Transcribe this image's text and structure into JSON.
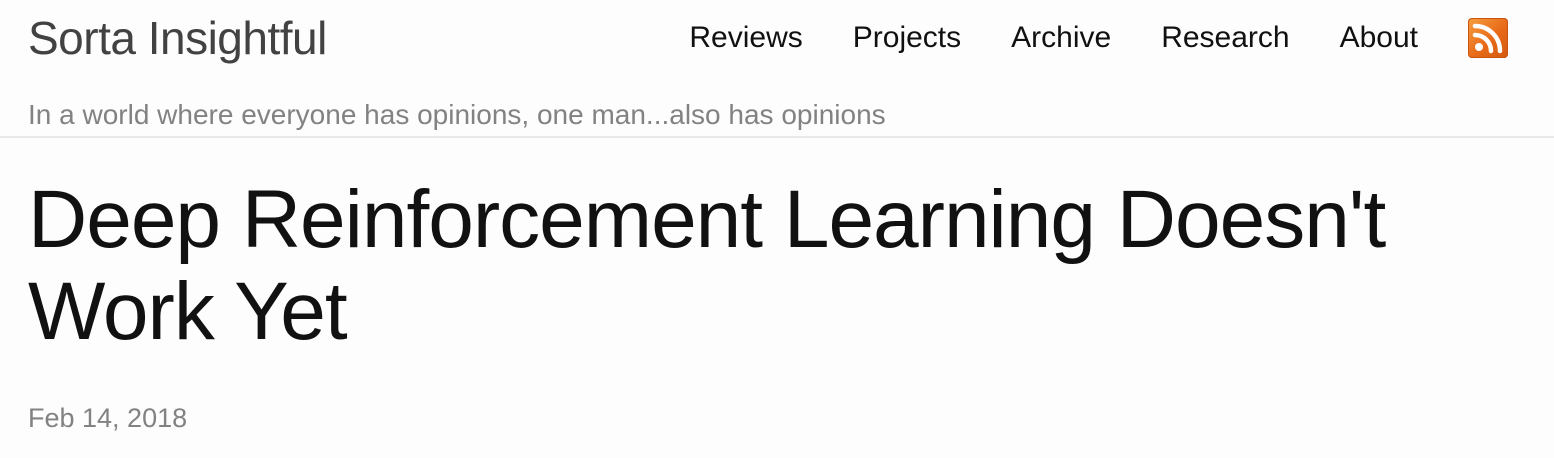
{
  "site": {
    "title": "Sorta Insightful",
    "tagline": "In a world where everyone has opinions, one man...also has opinions"
  },
  "nav": {
    "items": [
      {
        "label": "Reviews"
      },
      {
        "label": "Projects"
      },
      {
        "label": "Archive"
      },
      {
        "label": "Research"
      },
      {
        "label": "About"
      }
    ],
    "feed_icon": "rss-icon"
  },
  "post": {
    "title": "Deep Reinforcement Learning Doesn't Work Yet",
    "date": "Feb 14, 2018"
  },
  "colors": {
    "background": "#fdfdfd",
    "text": "#111111",
    "muted": "#828282",
    "rss_orange": "#e86a18"
  }
}
